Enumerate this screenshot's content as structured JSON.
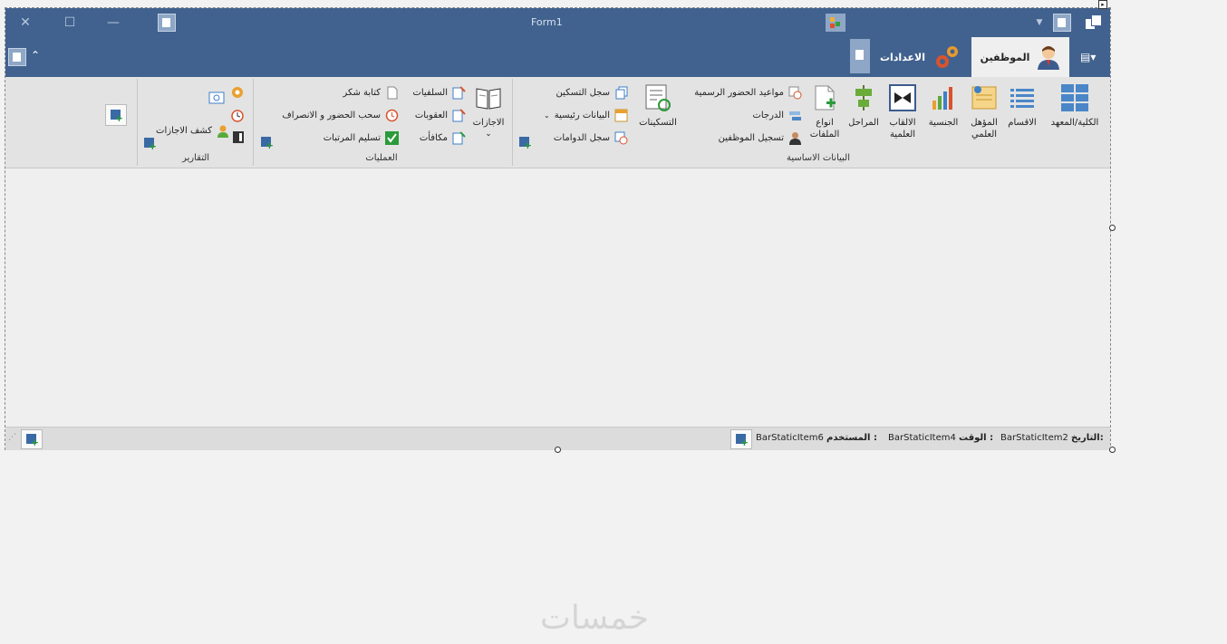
{
  "window": {
    "title": "Form1"
  },
  "tabs": [
    {
      "label": "الموظفين",
      "icon": "employee-icon"
    },
    {
      "label": "الاعدادات",
      "icon": "gears-icon"
    }
  ],
  "groups": {
    "basic": {
      "label": "البيانات الاساسية",
      "big": [
        "الكلية/المعهد",
        "الاقسام",
        "المؤهل العلمي",
        "الجنسية",
        "الالقاب العلمية",
        "المراحل",
        "انواع الملفات"
      ],
      "small": [
        "مواعيد الحضور الرسمية",
        "الدرجات",
        "تسجيل الموظفين"
      ],
      "tasknat_big": "التسكينات",
      "small2": [
        "سجل التسكين",
        "البيانات رئيسية",
        "سجل الدوامات"
      ]
    },
    "ops": {
      "label": "العمليات",
      "big": "الاجازات",
      "col1": [
        "السلفيات",
        "العقوبات",
        "مكافأت"
      ],
      "col2": [
        "كتابة شكر",
        "سحب الحضور و الانصراف",
        "تسليم المرتبات"
      ]
    },
    "reports": {
      "label": "التقارير",
      "item": "كشف الاجازات"
    }
  },
  "status": {
    "date_label": "التاريخ:",
    "date_value": "BarStaticItem2",
    "time_label": "الوقت :",
    "time_value": "BarStaticItem4",
    "user_label": "المستخدم :",
    "user_value": "BarStaticItem6"
  },
  "watermark": "خمسات"
}
